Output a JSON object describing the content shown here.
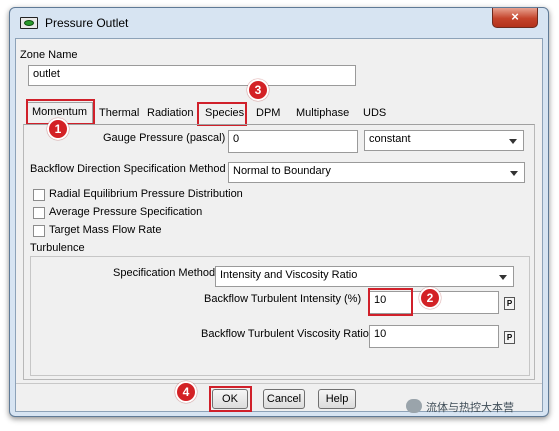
{
  "window": {
    "title": "Pressure Outlet",
    "close_glyph": "×"
  },
  "zone": {
    "label": "Zone Name",
    "value": "outlet"
  },
  "tabs": [
    {
      "label": "Momentum",
      "active": true
    },
    {
      "label": "Thermal"
    },
    {
      "label": "Radiation"
    },
    {
      "label": "Species"
    },
    {
      "label": "DPM"
    },
    {
      "label": "Multiphase"
    },
    {
      "label": "UDS"
    }
  ],
  "momentum": {
    "gauge_pressure": {
      "label": "Gauge Pressure (pascal)",
      "value": "0",
      "method": "constant"
    },
    "backflow_direction": {
      "label": "Backflow Direction Specification Method",
      "value": "Normal to Boundary"
    },
    "checkboxes": [
      {
        "label": "Radial Equilibrium Pressure Distribution",
        "checked": false
      },
      {
        "label": "Average Pressure Specification",
        "checked": false
      },
      {
        "label": "Target Mass Flow Rate",
        "checked": false
      }
    ],
    "turbulence": {
      "group_label": "Turbulence",
      "spec_method": {
        "label": "Specification Method",
        "value": "Intensity and Viscosity Ratio"
      },
      "intensity": {
        "label": "Backflow Turbulent Intensity (%)",
        "value": "10",
        "param_glyph": "P"
      },
      "viscosity_ratio": {
        "label": "Backflow Turbulent Viscosity Ratio",
        "value": "10",
        "param_glyph": "P"
      }
    }
  },
  "buttons": {
    "ok": "OK",
    "cancel": "Cancel",
    "help": "Help"
  },
  "annotations": {
    "badge1": "1",
    "badge2": "2",
    "badge3": "3",
    "badge4": "4",
    "highlight_color": "#d0202a"
  },
  "watermark": {
    "text": "流体与热控大本营",
    "icon": "wechat-icon"
  }
}
